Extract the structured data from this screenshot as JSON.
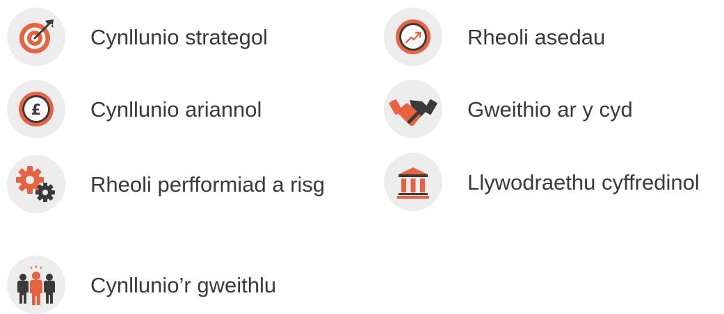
{
  "colors": {
    "accent": "#e8623f",
    "dark": "#3a3a3a",
    "icon_bg": "#ededed"
  },
  "items": [
    {
      "label": "Cynllunio strategol",
      "icon": "target-icon"
    },
    {
      "label": "Cynllunio ariannol",
      "icon": "pound-coin-icon"
    },
    {
      "label": "Rheoli perfformiad a risg",
      "icon": "gears-icon"
    },
    {
      "label": "Cynllunio’r gweithlu",
      "icon": "people-icon"
    },
    {
      "label": "Rheoli asedau",
      "icon": "growth-chart-icon"
    },
    {
      "label": "Gweithio ar y cyd",
      "icon": "handshake-icon"
    },
    {
      "label": "Llywodraethu cyffredinol",
      "icon": "government-building-icon"
    }
  ]
}
